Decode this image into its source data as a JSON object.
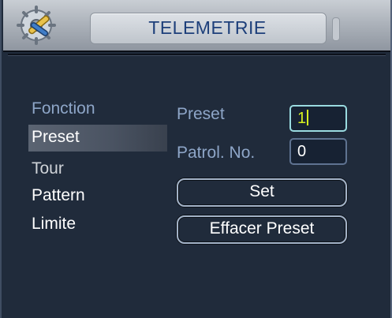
{
  "title": "TELEMETRIE",
  "icons": {
    "app": "gear-tools-icon"
  },
  "menu": {
    "heading": "Fonction",
    "items": [
      {
        "label": "Preset",
        "selected": true
      },
      {
        "label": "Tour",
        "selected": false
      },
      {
        "label": "Pattern",
        "selected": false
      },
      {
        "label": "Limite",
        "selected": false
      }
    ]
  },
  "form": {
    "preset_label": "Preset",
    "preset_value": "1",
    "patrol_label": "Patrol. No.",
    "patrol_value": "0"
  },
  "buttons": {
    "set": "Set",
    "clear": "Effacer Preset"
  },
  "colors": {
    "background": "#202b3b",
    "title_text": "#1d3f7a",
    "label_text": "#8ea6c8",
    "active_value": "#d6f020"
  }
}
